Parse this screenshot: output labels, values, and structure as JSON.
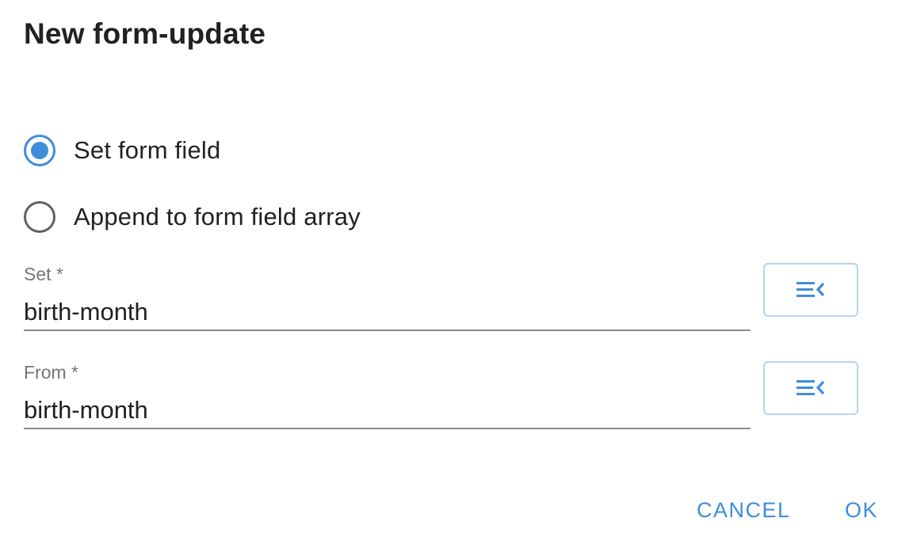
{
  "dialog": {
    "title": "New form-update"
  },
  "options": {
    "set_field": {
      "label": "Set form field",
      "selected": true
    },
    "append_array": {
      "label": "Append to form field array",
      "selected": false
    }
  },
  "fields": {
    "set": {
      "label": "Set *",
      "value": "birth-month"
    },
    "from": {
      "label": "From *",
      "value": "birth-month"
    }
  },
  "icons": {
    "picker": "list-select-icon"
  },
  "actions": {
    "cancel_label": "CANCEL",
    "ok_label": "OK"
  },
  "colors": {
    "accent": "#3f8ddb",
    "text": "#212121",
    "muted": "#757575"
  }
}
